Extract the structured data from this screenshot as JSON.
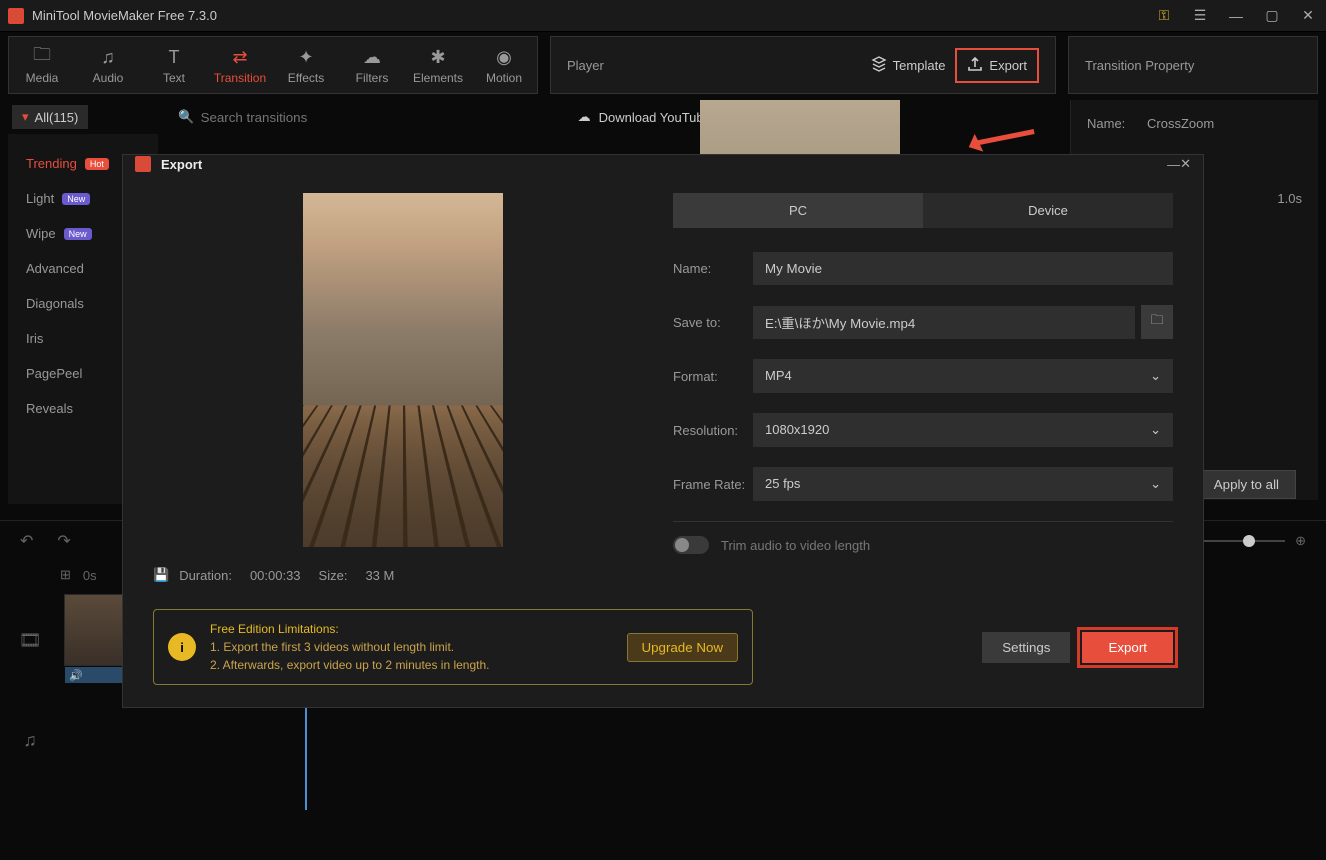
{
  "titlebar": {
    "title": "MiniTool MovieMaker Free 7.3.0"
  },
  "mediaTabs": [
    {
      "label": "Media",
      "icon": "🗀"
    },
    {
      "label": "Audio",
      "icon": "♫"
    },
    {
      "label": "Text",
      "icon": "T"
    },
    {
      "label": "Transition",
      "icon": "⇄",
      "active": true
    },
    {
      "label": "Effects",
      "icon": "✦"
    },
    {
      "label": "Filters",
      "icon": "☁"
    },
    {
      "label": "Elements",
      "icon": "✱"
    },
    {
      "label": "Motion",
      "icon": "◉"
    }
  ],
  "player": {
    "title": "Player",
    "template": "Template",
    "export": "Export"
  },
  "rightPanel": {
    "title": "Transition Property",
    "nameLabel": "Name:",
    "nameValue": "CrossZoom",
    "durLabel": "",
    "durValue": "1.0s",
    "applyAll": "Apply to all"
  },
  "filter": {
    "all": "All(115)",
    "searchPlaceholder": "Search transitions",
    "download": "Download YouTube Videos"
  },
  "categories": [
    {
      "label": "Trending",
      "badge": "Hot",
      "badgeClass": "hot",
      "active": true
    },
    {
      "label": "Light",
      "badge": "New",
      "badgeClass": "new"
    },
    {
      "label": "Wipe",
      "badge": "New",
      "badgeClass": "new"
    },
    {
      "label": "Advanced"
    },
    {
      "label": "Diagonals"
    },
    {
      "label": "Iris"
    },
    {
      "label": "PagePeel"
    },
    {
      "label": "Reveals"
    }
  ],
  "timeline": {
    "zero": "0s"
  },
  "dialog": {
    "title": "Export",
    "tabs": {
      "pc": "PC",
      "device": "Device"
    },
    "name": {
      "label": "Name:",
      "value": "My Movie"
    },
    "saveTo": {
      "label": "Save to:",
      "value": "E:\\重\\ほか\\My Movie.mp4"
    },
    "format": {
      "label": "Format:",
      "value": "MP4"
    },
    "resolution": {
      "label": "Resolution:",
      "value": "1080x1920"
    },
    "frameRate": {
      "label": "Frame Rate:",
      "value": "25 fps"
    },
    "trim": "Trim audio to video length",
    "meta": {
      "durationLabel": "Duration:",
      "duration": "00:00:33",
      "sizeLabel": "Size:",
      "size": "33 M"
    },
    "limitations": {
      "title": "Free Edition Limitations:",
      "l1": "1. Export the first 3 videos without length limit.",
      "l2": "2. Afterwards, export video up to 2 minutes in length.",
      "upgrade": "Upgrade Now"
    },
    "settings": "Settings",
    "export": "Export"
  }
}
